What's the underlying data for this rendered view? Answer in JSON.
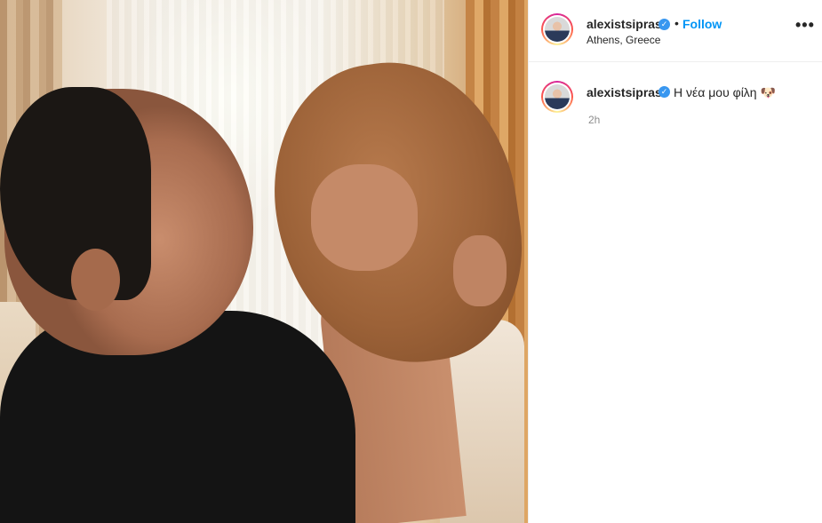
{
  "post": {
    "image_description_icon": "photo-icon"
  },
  "header": {
    "username": "alexistsipras",
    "verified_icon": "verified-badge-icon",
    "separator": "•",
    "follow_label": "Follow",
    "location": "Athens, Greece",
    "more_icon": "more-options-icon",
    "more_label": "•••"
  },
  "comment": {
    "username": "alexistsipras",
    "verified_icon": "verified-badge-icon",
    "caption": "Η νέα μου φίλη 🐶",
    "timestamp": "2h"
  },
  "colors": {
    "accent": "#0095f6",
    "verified": "#3897f0",
    "text": "#262626",
    "muted": "#8e8e8e",
    "divider": "#efefef"
  }
}
